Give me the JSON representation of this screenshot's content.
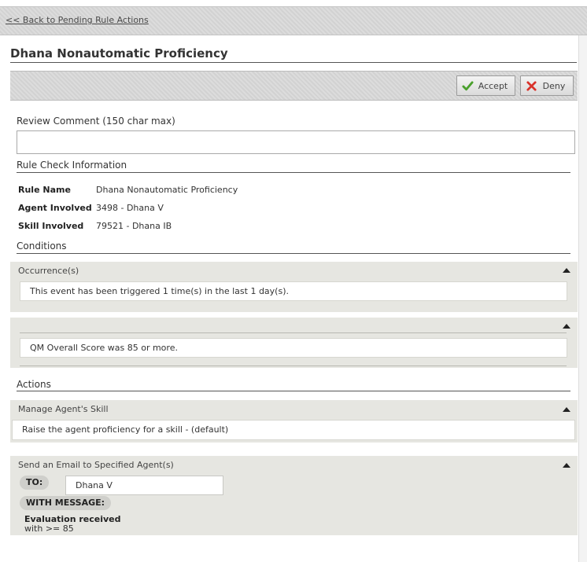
{
  "nav": {
    "back_link": "<< Back to Pending Rule Actions"
  },
  "page": {
    "title": "Dhana Nonautomatic Proficiency"
  },
  "toolbar": {
    "accept_label": "Accept",
    "deny_label": "Deny"
  },
  "review": {
    "label": "Review Comment (150 char max)",
    "value": "",
    "placeholder": ""
  },
  "rule_info": {
    "heading": "Rule Check Information",
    "rows": [
      {
        "key": "Rule Name",
        "value": "Dhana Nonautomatic Proficiency"
      },
      {
        "key": "Agent Involved",
        "value": "3498 - Dhana V"
      },
      {
        "key": "Skill Involved",
        "value": "79521 - Dhana IB"
      }
    ]
  },
  "conditions": {
    "heading": "Conditions",
    "panels": [
      {
        "title": "Occurrence(s)",
        "text": "This event has been triggered 1 time(s) in the last 1 day(s)."
      },
      {
        "title": "",
        "text": "QM Overall Score was 85 or more."
      }
    ]
  },
  "actions": {
    "heading": "Actions",
    "manage_skill": {
      "title": "Manage Agent's Skill",
      "text": "Raise the agent proficiency for a skill - (default)"
    },
    "email": {
      "title": "Send an Email to Specified Agent(s)",
      "to_label": "TO:",
      "to_value": "Dhana V",
      "message_label": "WITH MESSAGE:",
      "message_title": "Evaluation received",
      "message_body": "with >= 85"
    }
  },
  "colors": {
    "accept_icon": "#4aa02c",
    "deny_icon": "#d9322a",
    "panel_bg": "#e6e6e1"
  },
  "icons": {
    "accept": "checkmark-icon",
    "deny": "x-icon",
    "collapse": "triangle-up-icon"
  }
}
